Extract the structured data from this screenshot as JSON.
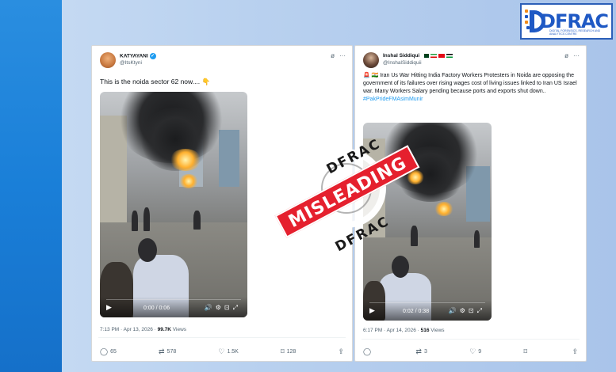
{
  "logo": {
    "brand": "DFRAC",
    "tagline": "DIGITAL FORENSICS, RESEARCH AND ANALYTICS CENTRE"
  },
  "tweet1": {
    "name": "KATYAYANI",
    "handle": "@ItsKtyni",
    "text": "This is the noida sector 62 now.... 👇",
    "video_time": "0:00 / 0:06",
    "timestamp": "7:13 PM · Apr 13, 2026 · ",
    "views": "99.7K",
    "views_label": " Views",
    "replies": "65",
    "reposts": "578",
    "likes": "1.5K",
    "bookmarks": "128"
  },
  "tweet2": {
    "name": "Inshal Siddiqui",
    "handle": "@InshalSiddiquii",
    "text": "🚨 🇮🇳 Iran Us War Hitting India Factory Workers Protesters in Noida are opposing the government of its failures over rising wages  cost of living issues linked to Iran US Israel war. Many Workers Salary pending because ports and exports shut down..",
    "hashtag": "#PakPrideFMAsimMunir",
    "video_time": "0:02 / 0:38",
    "timestamp": "6:17 PM · Apr 14, 2026 · ",
    "views": "516",
    "views_label": " Views",
    "replies": "",
    "reposts": "3",
    "likes": "9",
    "bookmarks": ""
  },
  "stamp": {
    "top": "DFRAC",
    "banner": "MISLEADING",
    "bottom": "DFRAC"
  },
  "icons": {
    "more": "more-icon",
    "grok": "grok-icon",
    "reply": "reply-icon",
    "repost": "repost-icon",
    "like": "like-icon",
    "bookmark": "bookmark-icon",
    "share": "share-icon"
  },
  "colors": {
    "accent": "#1d9bf0",
    "stamp_red": "#e5202e",
    "brand_blue": "#1f59c4"
  }
}
